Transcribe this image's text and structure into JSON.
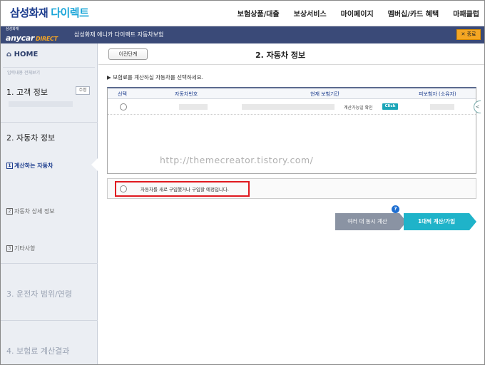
{
  "brand": {
    "name1": "삼성화재",
    "name2": "다이렉트"
  },
  "topnav": [
    "보험상품/대출",
    "보상서비스",
    "마이페이지",
    "멤버십/카드 혜택",
    "마패클럽"
  ],
  "appbar": {
    "logo_top": "삼성화재",
    "logo_main": "anycar",
    "logo_sub": "DIRECT",
    "title": "삼성화재 애니카 다이렉트 자동차보험",
    "close_label": "✕ 종료"
  },
  "sidebar": {
    "home": "⌂ HOME",
    "reset": "입력내용 전체보기",
    "step1": "1. 고객 정보",
    "edit_label": "수정",
    "step2": "2. 자동차 정보",
    "sub1_num": "1",
    "sub1": "계산하는 자동차",
    "sub2_num": "2",
    "sub2": "자동차 상세 정보",
    "sub3_num": "3",
    "sub3": "기타사항",
    "step3": "3. 운전자 범위/연령",
    "step4": "4. 보험료 계산결과"
  },
  "main": {
    "prev_label": "이전단계",
    "title": "2. 자동차 정보",
    "instruction": "▶ 보험료를 계산하실 자동차를 선택하세요.",
    "table": {
      "headers": [
        "선택",
        "자동차번호",
        "현재 보험기간",
        "피보험자 (소유자)"
      ],
      "row_confirm": "계산가능일 확인",
      "row_click": "Click"
    },
    "new_car_text": "자동차를 새로 구입했거나 구입할 예정입니다.",
    "help": "?",
    "btn_multi": "여러 대 동시 계산",
    "btn_single": "1대씩 계산/가입"
  },
  "watermark": "http://themecreator.tistory.com/"
}
